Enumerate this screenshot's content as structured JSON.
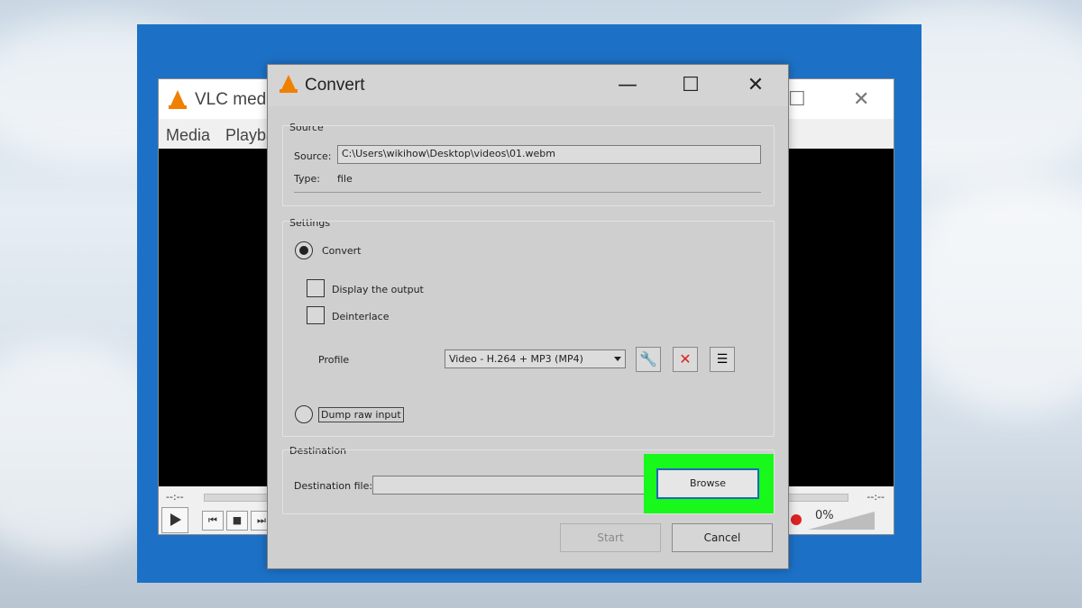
{
  "vlc": {
    "title": "VLC media",
    "menu": [
      "Media",
      "Playba"
    ],
    "time_left": "--:--",
    "time_right": "--:--",
    "volume": "0%"
  },
  "dialog": {
    "title": "Convert",
    "source": {
      "group_label": "Source",
      "source_label": "Source:",
      "source_value": "C:\\Users\\wikihow\\Desktop\\videos\\01.webm",
      "type_label": "Type:",
      "type_value": "file"
    },
    "settings": {
      "group_label": "Settings",
      "convert_label": "Convert",
      "display_output_label": "Display the output",
      "deinterlace_label": "Deinterlace",
      "profile_label": "Profile",
      "profile_value": "Video - H.264 + MP3 (MP4)",
      "dump_raw_label": "Dump raw input"
    },
    "destination": {
      "group_label": "Destination",
      "file_label": "Destination file:",
      "file_value": "",
      "browse_label": "Browse"
    },
    "buttons": {
      "start": "Start",
      "cancel": "Cancel"
    }
  },
  "colors": {
    "highlight": "#18f81a",
    "desktop": "#1c71c7",
    "vlc_orange": "#f08000"
  }
}
